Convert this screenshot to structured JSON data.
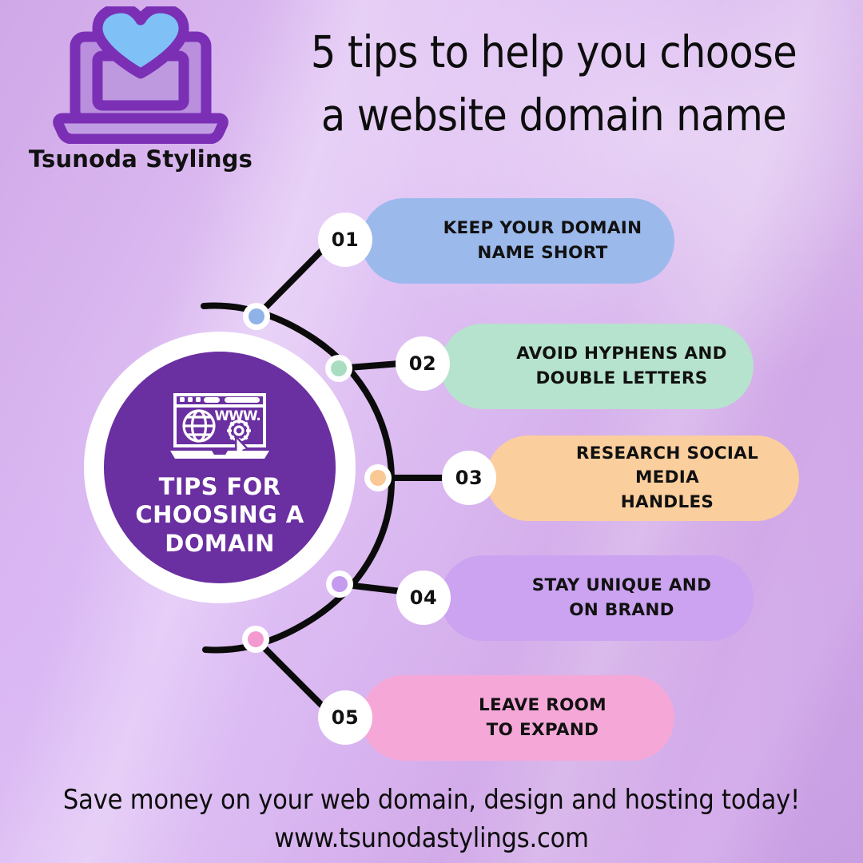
{
  "brand": {
    "name": "Tsunoda Stylings",
    "logo_icon": "laptop-heart-icon"
  },
  "headline": {
    "line1": "5 tips to help you choose",
    "line2": "a website domain name"
  },
  "hub": {
    "icon": "browser-globe-gear-icon",
    "title_line1": "TIPS FOR",
    "title_line2": "CHOOSING A",
    "title_line3": "DOMAIN",
    "circle_color": "#6A2FA0",
    "ring_color": "#FFFFFF",
    "text_color": "#FFFFFF"
  },
  "tips": [
    {
      "number": "01",
      "line1": "KEEP YOUR DOMAIN",
      "line2": "NAME SHORT",
      "color": "#9CB9EB",
      "dot_color": "#8FB2E8"
    },
    {
      "number": "02",
      "line1": "AVOID HYPHENS AND",
      "line2": "DOUBLE LETTERS",
      "color": "#B6E3CD",
      "dot_color": "#A8DDC2"
    },
    {
      "number": "03",
      "line1": "RESEARCH SOCIAL MEDIA",
      "line2": "HANDLES",
      "color": "#FBCE9D",
      "dot_color": "#FAC894"
    },
    {
      "number": "04",
      "line1": "STAY UNIQUE AND",
      "line2": "ON BRAND",
      "color": "#CBA3F0",
      "dot_color": "#C49BEE"
    },
    {
      "number": "05",
      "line1": "LEAVE ROOM",
      "line2": "TO EXPAND",
      "color": "#F5A8D8",
      "dot_color": "#F39BD1"
    }
  ],
  "footer": {
    "line1": "Save money on your web domain, design and hosting today!",
    "line2": "www.tsunodastylings.com"
  },
  "theme": {
    "background_start": "#CFA8E8",
    "background_end": "#C9A0E2",
    "connector_color": "#0B0B0B",
    "badge_bg": "#FFFFFF",
    "text_dark": "#111111"
  }
}
